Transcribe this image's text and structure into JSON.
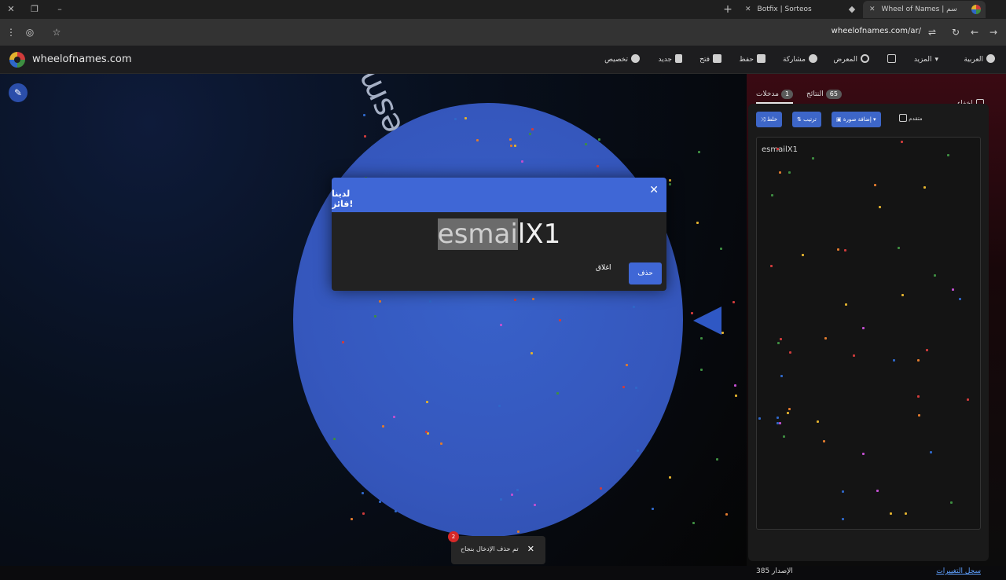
{
  "browser": {
    "tabs": [
      {
        "label": "Botfix | Sorteos"
      },
      {
        "label": "Wheel of Names | سم العشوائي"
      }
    ],
    "url": "wheelofnames.com/ar/"
  },
  "site": {
    "brand": "wheelofnames.com",
    "nav": [
      {
        "label": "العربية",
        "icon": "globe-icon"
      },
      {
        "label": "المزيد",
        "icon": "chevron-down-icon"
      },
      {
        "label": "المعرض",
        "icon": "fullscreen-icon"
      },
      {
        "label": "مشاركة",
        "icon": "search-icon"
      },
      {
        "label": "حفظ",
        "icon": "share-icon"
      },
      {
        "label": "فتح",
        "icon": "save-icon"
      },
      {
        "label": "جديد",
        "icon": "folder-icon"
      },
      {
        "label": "تخصيص",
        "icon": "file-icon"
      }
    ]
  },
  "wheel": {
    "segment_label": "esmailX1"
  },
  "panel": {
    "entries_tab": {
      "label": "مدخلات",
      "count": "1"
    },
    "results_tab": {
      "label": "النتائج",
      "count": "65"
    },
    "hide_label": "إخفاء",
    "toolbar": {
      "shuffle": "خلط",
      "sort": "ترتيب",
      "add_image": "إضافة صورة",
      "advanced": "متقدم"
    },
    "entries": [
      "esmailX1"
    ],
    "version": "الإصدار 385",
    "changelog": "سجل التغييرات"
  },
  "modal": {
    "title": "لدينا فائز!",
    "winner_part1": "esmai",
    "winner_part2": "lX1",
    "close_label": "اغلاق",
    "delete_label": "حذف"
  },
  "toast": {
    "message": "تم حذف الإدخال بنجاح",
    "badge": "2"
  },
  "colors": {
    "accent": "#3f67d6",
    "wheel": "#3557bd"
  }
}
